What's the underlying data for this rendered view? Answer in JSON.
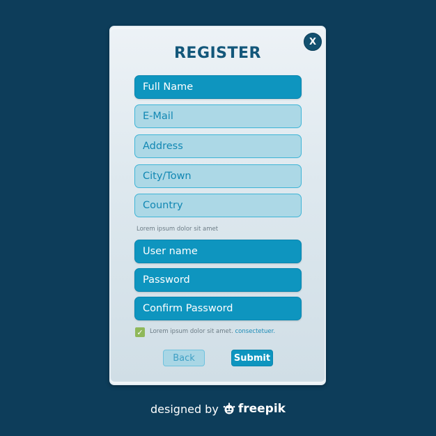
{
  "dialog": {
    "title": "REGISTER",
    "close_label": "X",
    "fields_group1": [
      {
        "label": "Full Name",
        "style": "dark"
      },
      {
        "label": "E-Mail",
        "style": "light"
      },
      {
        "label": "Address",
        "style": "light"
      },
      {
        "label": "City/Town",
        "style": "light"
      },
      {
        "label": "Country",
        "style": "light"
      }
    ],
    "hint_text": "Lorem ipsum dolor sit amet",
    "fields_group2": [
      {
        "label": "User name",
        "style": "dark"
      },
      {
        "label": "Password",
        "style": "dark"
      },
      {
        "label": "Confirm Password",
        "style": "dark"
      }
    ],
    "agreement": {
      "checked": true,
      "text": "Lorem ipsum dolor sit amet.",
      "link_text": "consectetuer."
    },
    "buttons": {
      "back_label": "Back",
      "submit_label": "Submit"
    }
  },
  "footer": {
    "prefix": "designed by",
    "brand": "freepik"
  },
  "colors": {
    "background": "#0d3d5a",
    "accent": "#0e95bf",
    "title": "#13577a",
    "check": "#8fb85a"
  }
}
